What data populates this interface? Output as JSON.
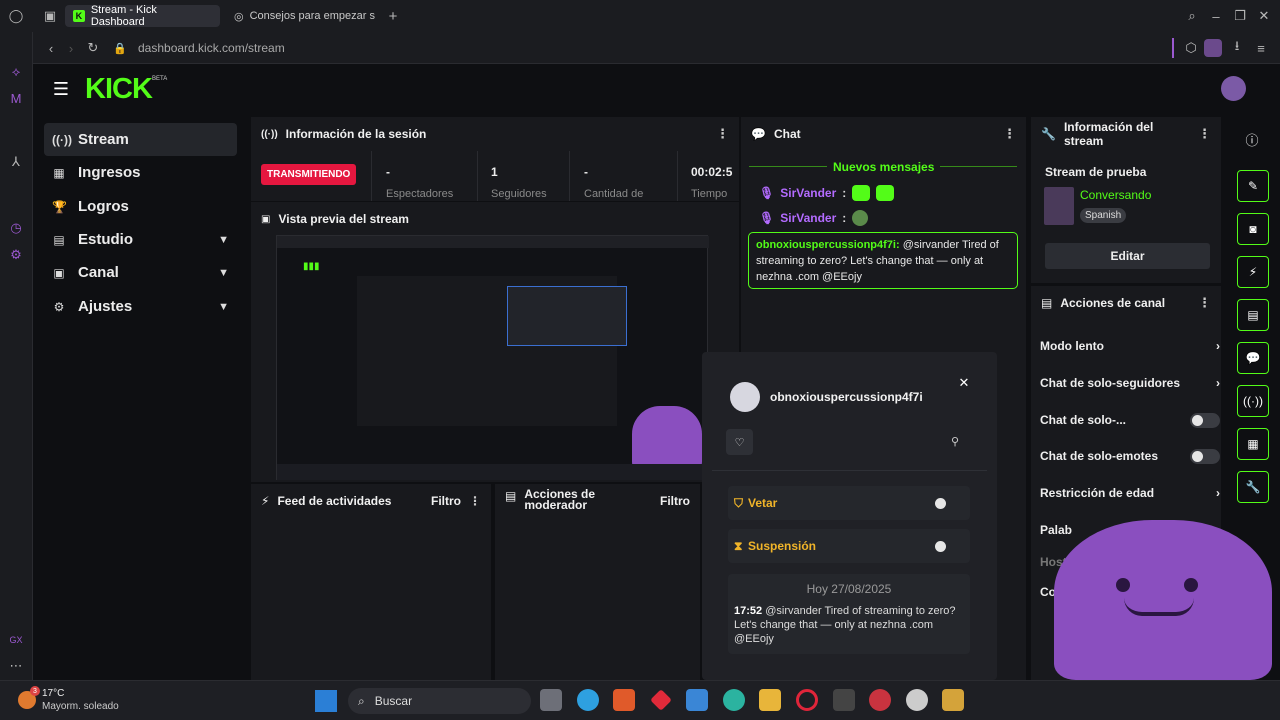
{
  "browser": {
    "tabs": [
      {
        "label": "Stream - Kick Dashboard",
        "active": true
      },
      {
        "label": "Consejos para empezar s",
        "active": false
      }
    ],
    "new_tab": "+",
    "url": "dashboard.kick.com/stream"
  },
  "app": {
    "logo": "KICK",
    "logo_badge": "BETA",
    "nav": [
      {
        "label": "Stream",
        "icon": "broadcast-icon",
        "glyph": "((·))",
        "selected": true
      },
      {
        "label": "Ingresos",
        "icon": "wallet-icon",
        "glyph": "▦"
      },
      {
        "label": "Logros",
        "icon": "trophy-icon",
        "glyph": "🏆"
      },
      {
        "label": "Estudio",
        "icon": "studio-icon",
        "glyph": "▤",
        "expandable": true
      },
      {
        "label": "Canal",
        "icon": "channel-icon",
        "glyph": "▣",
        "expandable": true
      },
      {
        "label": "Ajustes",
        "icon": "gear-icon",
        "glyph": "⚙",
        "expandable": true
      }
    ]
  },
  "session": {
    "title": "Información de la sesión",
    "live_badge": "TRANSMITIENDO",
    "stats": [
      {
        "value": "-",
        "label": "Espectadores"
      },
      {
        "value": "1",
        "label": "Seguidores"
      },
      {
        "value": "-",
        "label": "Cantidad de"
      },
      {
        "value": "00:02:5",
        "label": "Tiempo"
      }
    ]
  },
  "preview": {
    "title": "Vista previa del stream"
  },
  "activity": {
    "title": "Feed de actividades",
    "filter": "Filtro"
  },
  "moderator": {
    "title": "Acciones de moderador",
    "filter": "Filtro"
  },
  "chat": {
    "title": "Chat",
    "new_messages": "Nuevos mensajes",
    "messages": [
      {
        "user": "SirVander",
        "text": ""
      },
      {
        "user": "SirVander",
        "text": ""
      }
    ],
    "highlight_user": "obnoxiouspercussionp4f7i",
    "highlight_text": "@sirvander Tired of streaming to zero? Let's change that — only at nezhna .com @EEojy"
  },
  "stream_info": {
    "title": "Información del stream",
    "stream_title": "Stream de prueba",
    "category": "Conversando",
    "language": "Spanish",
    "edit_button": "Editar"
  },
  "channel_actions": {
    "title": "Acciones de canal",
    "items": [
      {
        "label": "Modo lento",
        "control": "arrow"
      },
      {
        "label": "Chat de solo-seguidores",
        "control": "arrow"
      },
      {
        "label": "Chat de solo-...",
        "control": "toggle"
      },
      {
        "label": "Chat de solo-emotes",
        "control": "toggle"
      },
      {
        "label": "Restricción de edad",
        "control": "arrow"
      },
      {
        "label": "Palab",
        "control": "arrow"
      },
      {
        "label": "Hoste",
        "control": "none"
      },
      {
        "label": "Conf",
        "control": "none"
      }
    ]
  },
  "user_popup": {
    "username": "obnoxiouspercussionp4f7i",
    "ban_label": "Vetar",
    "timeout_label": "Suspensión",
    "date": "Hoy 27/08/2025",
    "msg_time": "17:52",
    "msg_text": "@sirvander Tired of streaming to zero? Let's change that — only at nezhna .com @EEojy"
  },
  "taskbar": {
    "weather_temp": "17°C",
    "weather_desc": "Mayorm. soleado",
    "weather_badge": "3",
    "search_placeholder": "Buscar"
  },
  "colors": {
    "accent": "#53fc18",
    "live": "#e5173f",
    "panel": "#18191d",
    "bg": "#0e0f12"
  }
}
